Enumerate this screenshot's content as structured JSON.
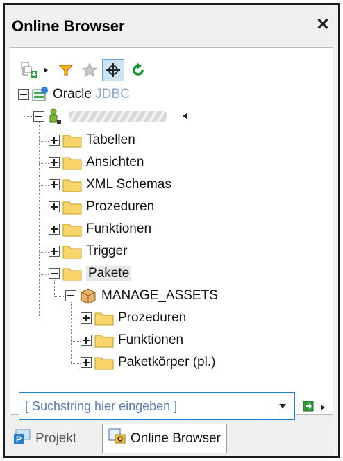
{
  "window": {
    "title": "Online Browser"
  },
  "toolbar": {
    "buttons": [
      {
        "name": "add-object-icon"
      },
      {
        "name": "filter-icon"
      },
      {
        "name": "favorite-star-icon"
      },
      {
        "name": "locate-crosshair-icon"
      },
      {
        "name": "refresh-icon"
      }
    ]
  },
  "tree": {
    "root": {
      "label": "Oracle",
      "sublabel": "JDBC"
    },
    "items": [
      {
        "label": "Tabellen"
      },
      {
        "label": "Ansichten"
      },
      {
        "label": "XML Schemas"
      },
      {
        "label": "Prozeduren"
      },
      {
        "label": "Funktionen"
      },
      {
        "label": "Trigger"
      },
      {
        "label": "Pakete"
      }
    ],
    "package": {
      "label": "MANAGE_ASSETS"
    },
    "package_items": [
      {
        "label": "Prozeduren"
      },
      {
        "label": "Funktionen"
      },
      {
        "label": "Paketkörper (pl.)"
      }
    ]
  },
  "search": {
    "placeholder": "[ Suchstring hier eingeben ]"
  },
  "tabs": [
    {
      "label": "Projekt"
    },
    {
      "label": "Online Browser"
    }
  ],
  "colors": {
    "accent": "#1d7fd4",
    "folder": "#f4c94f",
    "refresh": "#1a8f2e"
  }
}
